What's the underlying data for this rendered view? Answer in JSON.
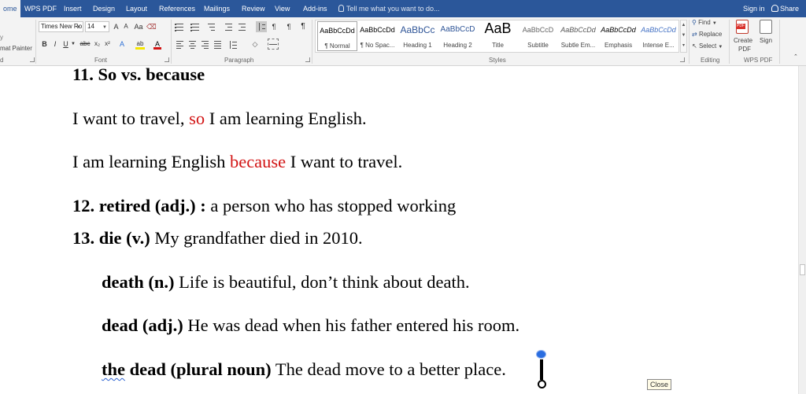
{
  "tabs": [
    "ome",
    "WPS PDF",
    "Insert",
    "Design",
    "Layout",
    "References",
    "Mailings",
    "Review",
    "View",
    "Add-ins"
  ],
  "tell_me": "Tell me what you want to do...",
  "sign_in": "Sign in",
  "share": "Share",
  "clipboard": {
    "format_painter": "mat Painter",
    "copy_fragment": "y",
    "group_fragment": "d"
  },
  "font": {
    "family": "Times New Ro",
    "size": "14",
    "bold": "B",
    "italic": "I",
    "underline": "U",
    "strike": "abc",
    "subscript": "x₂",
    "superscript": "x²",
    "grow": "A",
    "shrink": "A",
    "case": "Aa",
    "group_label": "Font"
  },
  "paragraph": {
    "group_label": "Paragraph",
    "pilcrow": "¶"
  },
  "styles": {
    "group_label": "Styles",
    "items": [
      {
        "preview": "AaBbCcDd",
        "name": "¶ Normal"
      },
      {
        "preview": "AaBbCcDd",
        "name": "¶ No Spac..."
      },
      {
        "preview": "AaBbCc",
        "name": "Heading 1"
      },
      {
        "preview": "AaBbCcD",
        "name": "Heading 2"
      },
      {
        "preview": "AaB",
        "name": "Title"
      },
      {
        "preview": "AaBbCcD",
        "name": "Subtitle"
      },
      {
        "preview": "AaBbCcDd",
        "name": "Subtle Em..."
      },
      {
        "preview": "AaBbCcDd",
        "name": "Emphasis"
      },
      {
        "preview": "AaBbCcDd",
        "name": "Intense E..."
      }
    ]
  },
  "editing": {
    "find": "Find",
    "replace": "Replace",
    "select": "Select",
    "group_label": "Editing"
  },
  "wps_pdf": {
    "create_pdf_1": "Create",
    "create_pdf_2": "PDF",
    "sign": "Sign",
    "group_label": "WPS PDF",
    "pdf_badge": "PDF"
  },
  "document": {
    "heading11": "11. So vs. because",
    "l1": {
      "a": "I want to travel, ",
      "b": "so",
      "c": " I am learning English."
    },
    "l2": {
      "a": "I am learning English ",
      "b": "because",
      "c": " I want to travel."
    },
    "l3": {
      "bold": "12. retired (adj.) : ",
      "rest": "a person who has stopped working"
    },
    "l4": {
      "bold": "13. die (v.) ",
      "rest": "My grandfather died in 2010."
    },
    "l5": {
      "bold": "death (n.) ",
      "rest": "Life is beautiful, don’t think about death."
    },
    "l6": {
      "bold": "dead (adj.) ",
      "rest": "He was dead when his father entered his room."
    },
    "l7": {
      "bold_a": "the",
      "bold_b": " dead (plural noun)",
      "rest": "  The dead move to a better place."
    }
  },
  "tooltip": "Close"
}
